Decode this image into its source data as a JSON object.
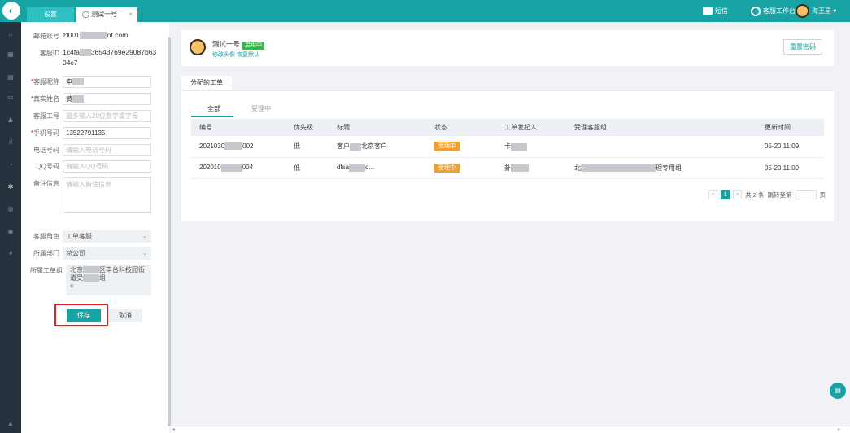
{
  "app": {
    "logo_glyph": "◐"
  },
  "tabs": [
    {
      "label": "设置",
      "active": false
    },
    {
      "label": "◯ 测试一号",
      "active": true,
      "close": "×"
    }
  ],
  "topright": {
    "sms": "短信",
    "workbench": "客服工作台",
    "user": "海王星 ▾"
  },
  "leftnav": [
    "⌂",
    "▦",
    "▤",
    "▭",
    "♟",
    "ıl",
    "◔",
    "✲",
    "◍",
    "◉",
    "◕",
    "▲"
  ],
  "form": {
    "email": {
      "label": "邮箱账号",
      "prefix": "zt001",
      "suffix": "ot.com"
    },
    "agent_id": {
      "label": "客服ID",
      "line1_prefix": "1c4fa",
      "line1_suffix": "36543769e29087b63",
      "line2": "04c7"
    },
    "nickname": {
      "label": "客服昵称",
      "required": "*",
      "value": "申"
    },
    "realname": {
      "label": "真实姓名",
      "required": "*",
      "value": "黄"
    },
    "job_no": {
      "label": "客服工号",
      "placeholder": "最多输入20位数字或字母"
    },
    "mobile": {
      "label": "手机号码",
      "required": "*",
      "value": "13522791135"
    },
    "phone": {
      "label": "电话号码",
      "placeholder": "请输入电话号码"
    },
    "qq": {
      "label": "QQ号码",
      "placeholder": "请输入QQ号码"
    },
    "remark": {
      "label": "备注信息",
      "placeholder": "请输入备注信息"
    },
    "role": {
      "label": "客服角色",
      "value": "工单客服"
    },
    "dept": {
      "label": "所属部门",
      "value": "总公司"
    },
    "group": {
      "label": "所属工单组",
      "line1": "北京",
      "line1_tail": "区丰台科技园街",
      "line2": "道受",
      "line2_tail": "组",
      "remove": "×"
    },
    "save": "保存",
    "cancel": "取消"
  },
  "profile": {
    "name": "测试一号",
    "status": "启用中",
    "links": "修改头像 恢复默认",
    "reset": "重置密码"
  },
  "section_tab": "分配的工单",
  "subtabs": [
    "全部",
    "受理中"
  ],
  "table": {
    "headers": [
      "编号",
      "优先级",
      "标题",
      "状态",
      "工单发起人",
      "受理客服组",
      "更新时间"
    ],
    "rows": [
      {
        "id_a": "2021030",
        "id_b": "002",
        "priority": "低",
        "title_a": "客户",
        "title_b": "北京客户",
        "status": "受理中",
        "initiator": "卡",
        "group": "",
        "updated": "05-20 11:09"
      },
      {
        "id_a": "202010",
        "id_b": "004",
        "priority": "低",
        "title_a": "dfsa",
        "title_b": "d...",
        "status": "受理中",
        "initiator": "卦",
        "group_a": "北",
        "group_b": "理专用组",
        "updated": "05-20 11:09"
      }
    ]
  },
  "pager": {
    "prev": "<",
    "page": "1",
    "next": ">",
    "total": "共 2 条",
    "jump": "跳转至第",
    "unit": "页"
  },
  "fab_glyph": "▤",
  "scroll": {
    "left": "◂",
    "right": "▸"
  }
}
